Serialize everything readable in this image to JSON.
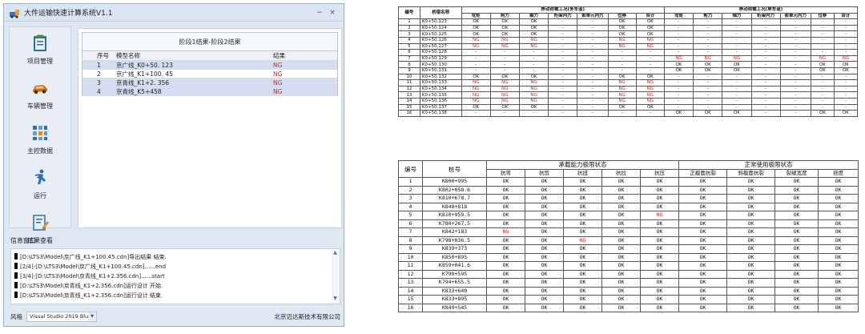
{
  "window": {
    "title": "大件运输快速计算系统V1.1",
    "minimize": "−",
    "close": "×"
  },
  "sidebar": {
    "items": [
      {
        "label": "项目管理",
        "icon": "clipboard-icon"
      },
      {
        "label": "车辆管理",
        "icon": "car-icon"
      },
      {
        "label": "主控数据",
        "icon": "grid-data-icon"
      },
      {
        "label": "运行",
        "icon": "running-man-icon"
      },
      {
        "label": "结果查看",
        "icon": "edit-document-icon"
      }
    ]
  },
  "result_grid": {
    "title": "阶段1结果-阶段2结果",
    "headers": [
      "序号",
      "模型名称",
      "结果"
    ],
    "rows": [
      {
        "no": "1",
        "name": "京广线_K0+50. 123",
        "result": "NG"
      },
      {
        "no": "2",
        "name": "京广线_K1+100. 45",
        "result": "NG"
      },
      {
        "no": "3",
        "name": "京青线_K1+2. 356",
        "result": "NG"
      },
      {
        "no": "4",
        "name": "京青线_K5+458",
        "result": "NG"
      }
    ]
  },
  "info_panel": {
    "label": "信息窗口",
    "lines": [
      "[D:\\LTS3\\Model\\京广线_K1+100.45.cdn]导出结果 结束.",
      "[2/4]-[D:\\LTS3\\Model\\京广线_K1+100.45.cdn]......end",
      "[3/4]-[D:\\LTS3\\Model\\京青线_K1+2.356.cdn]......start",
      "[D:\\LTS3\\Model\\京青线_K1+2.356.cdn]运行设计 开始.",
      "[D:\\LTS3\\Model\\京青线_K1+2.356.cdn]运行设计 结束."
    ]
  },
  "footer": {
    "style_label": "风格",
    "style_value": "Visual Studio 2019 Blue",
    "company": "北京迈达斯技术有限公司"
  },
  "table_top": {
    "col_no": "编号",
    "col_name": "桥梁名称",
    "group_multi": "移动荷载工况(多车道)",
    "group_single": "移动荷载工况(单车道)",
    "sub_headers": [
      "弯矩",
      "剪力",
      "轴力",
      "桁架内力",
      "索单元内力",
      "位移",
      "合计"
    ],
    "rows": [
      {
        "no": "1",
        "pile": "K0+50.123",
        "multi": [
          "OK",
          "OK",
          "OK",
          "-",
          "-",
          "OK",
          "OK"
        ],
        "single": [
          "-",
          "-",
          "-",
          "-",
          "-",
          "-",
          "-"
        ]
      },
      {
        "no": "2",
        "pile": "K0+50.124",
        "multi": [
          "OK",
          "OK",
          "OK",
          "-",
          "-",
          "OK",
          "OK"
        ],
        "single": [
          "-",
          "-",
          "-",
          "-",
          "-",
          "-",
          "-"
        ]
      },
      {
        "no": "3",
        "pile": "K0+50.125",
        "multi": [
          "OK",
          "OK",
          "OK",
          "-",
          "-",
          "OK",
          "OK"
        ],
        "single": [
          "-",
          "-",
          "-",
          "-",
          "-",
          "-",
          "-"
        ]
      },
      {
        "no": "4",
        "pile": "K0+50.126",
        "multi": [
          "NG",
          "NG",
          "NG",
          "-",
          "-",
          "NG",
          "NG"
        ],
        "single": [
          "-",
          "-",
          "-",
          "-",
          "-",
          "-",
          "-"
        ]
      },
      {
        "no": "5",
        "pile": "K0+50.127",
        "multi": [
          "NG",
          "NG",
          "NG",
          "-",
          "-",
          "NG",
          "NG"
        ],
        "single": [
          "-",
          "-",
          "-",
          "-",
          "-",
          "-",
          "-"
        ]
      },
      {
        "no": "6",
        "pile": "K0+50.128",
        "multi": [
          "-",
          "-",
          "-",
          "-",
          "-",
          "-",
          "-"
        ],
        "single": [
          "-",
          "-",
          "-",
          "-",
          "-",
          "-",
          "-"
        ]
      },
      {
        "no": "7",
        "pile": "K0+50.129",
        "multi": [
          "-",
          "-",
          "-",
          "-",
          "-",
          "-",
          "-"
        ],
        "single": [
          "NG",
          "NG",
          "NG",
          "-",
          "-",
          "NG",
          "NG"
        ]
      },
      {
        "no": "8",
        "pile": "K0+50.130",
        "multi": [
          "-",
          "-",
          "-",
          "-",
          "-",
          "-",
          "-"
        ],
        "single": [
          "OK",
          "OK",
          "OK",
          "-",
          "-",
          "OK",
          "OK"
        ]
      },
      {
        "no": "9",
        "pile": "K0+50.131",
        "multi": [
          "-",
          "-",
          "-",
          "-",
          "-",
          "-",
          "-"
        ],
        "single": [
          "OK",
          "OK",
          "OK",
          "-",
          "-",
          "OK",
          "OK"
        ]
      },
      {
        "no": "10",
        "pile": "K0+50.132",
        "multi": [
          "OK",
          "OK",
          "OK",
          "-",
          "-",
          "OK",
          "OK"
        ],
        "single": [
          "-",
          "-",
          "-",
          "-",
          "-",
          "-",
          "-"
        ]
      },
      {
        "no": "11",
        "pile": "K0+50.133",
        "multi": [
          "NG",
          "NG",
          "NG",
          "-",
          "-",
          "NG",
          "NG"
        ],
        "single": [
          "-",
          "-",
          "-",
          "-",
          "-",
          "-",
          "-"
        ]
      },
      {
        "no": "12",
        "pile": "K0+50.134",
        "multi": [
          "NG",
          "NG",
          "NG",
          "-",
          "-",
          "NG",
          "NG"
        ],
        "single": [
          "-",
          "-",
          "-",
          "-",
          "-",
          "-",
          "-"
        ]
      },
      {
        "no": "13",
        "pile": "K0+50.135",
        "multi": [
          "NG",
          "NG",
          "NG",
          "-",
          "-",
          "NG",
          "NG"
        ],
        "single": [
          "-",
          "-",
          "-",
          "-",
          "-",
          "-",
          "-"
        ]
      },
      {
        "no": "14",
        "pile": "K0+50.136",
        "multi": [
          "NG",
          "NG",
          "NG",
          "-",
          "-",
          "NG",
          "NG"
        ],
        "single": [
          "-",
          "-",
          "-",
          "-",
          "-",
          "-",
          "-"
        ]
      },
      {
        "no": "15",
        "pile": "K0+50.137",
        "multi": [
          "OK",
          "OK",
          "OK",
          "-",
          "-",
          "OK",
          "OK"
        ],
        "single": [
          "-",
          "-",
          "-",
          "-",
          "-",
          "-",
          "-"
        ]
      },
      {
        "no": "16",
        "pile": "K0+50.138",
        "multi": [
          "-",
          "-",
          "-",
          "-",
          "-",
          "-",
          "-"
        ],
        "single": [
          "OK",
          "OK",
          "OK",
          "-",
          "-",
          "OK",
          "OK"
        ]
      }
    ]
  },
  "table_bottom": {
    "col_no": "编号",
    "col_pile": "桩号",
    "group_capacity": "承载能力极限状态",
    "group_service": "正常使用极限状态",
    "capacity_headers": [
      "抗弯",
      "抗剪",
      "抗扭",
      "抗拉",
      "抗压"
    ],
    "service_headers": [
      "正截面抗裂",
      "斜截面抗裂",
      "裂缝宽度",
      "挠度"
    ],
    "rows": [
      {
        "no": "1",
        "pile": "K800+995",
        "vals": [
          "OK",
          "OK",
          "OK",
          "OK",
          "OK",
          "OK",
          "OK",
          "OK",
          "OK"
        ]
      },
      {
        "no": "2",
        "pile": "K802+058.6",
        "vals": [
          "OK",
          "OK",
          "OK",
          "OK",
          "OK",
          "OK",
          "OK",
          "OK",
          "OK"
        ]
      },
      {
        "no": "3",
        "pile": "K810+678.7",
        "vals": [
          "OK",
          "OK",
          "OK",
          "OK",
          "OK",
          "OK",
          "OK",
          "OK",
          "OK"
        ]
      },
      {
        "no": "4",
        "pile": "K848+818",
        "vals": [
          "OK",
          "OK",
          "OK",
          "OK",
          "OK",
          "OK",
          "OK",
          "OK",
          "OK"
        ]
      },
      {
        "no": "5",
        "pile": "K810+959.5",
        "vals": [
          "OK",
          "OK",
          "OK",
          "OK",
          "NG",
          "OK",
          "OK",
          "OK",
          "OK"
        ]
      },
      {
        "no": "6",
        "pile": "K780+267.5",
        "vals": [
          "OK",
          "OK",
          "OK",
          "OK",
          "OK",
          "OK",
          "OK",
          "OK",
          "OK"
        ]
      },
      {
        "no": "7",
        "pile": "K842+183",
        "vals": [
          "NG",
          "OK",
          "OK",
          "OK",
          "OK",
          "OK",
          "OK",
          "OK",
          "OK"
        ]
      },
      {
        "no": "8",
        "pile": "K798+036.5",
        "vals": [
          "OK",
          "OK",
          "NG",
          "OK",
          "OK",
          "OK",
          "OK",
          "OK",
          "OK"
        ]
      },
      {
        "no": "9",
        "pile": "K839+373",
        "vals": [
          "OK",
          "OK",
          "OK",
          "OK",
          "OK",
          "OK",
          "OK",
          "OK",
          "OK"
        ]
      },
      {
        "no": "10",
        "pile": "K850+895",
        "vals": [
          "OK",
          "OK",
          "OK",
          "OK",
          "OK",
          "OK",
          "OK",
          "OK",
          "OK"
        ]
      },
      {
        "no": "11",
        "pile": "K859+041.6",
        "vals": [
          "OK",
          "OK",
          "OK",
          "OK",
          "OK",
          "OK",
          "OK",
          "OK",
          "OK"
        ]
      },
      {
        "no": "12",
        "pile": "K790+595",
        "vals": [
          "OK",
          "OK",
          "OK",
          "OK",
          "OK",
          "OK",
          "OK",
          "OK",
          "OK"
        ]
      },
      {
        "no": "13",
        "pile": "K794+655.5",
        "vals": [
          "OK",
          "OK",
          "OK",
          "OK",
          "OK",
          "OK",
          "OK",
          "OK",
          "OK"
        ]
      },
      {
        "no": "14",
        "pile": "K833+640",
        "vals": [
          "OK",
          "OK",
          "OK",
          "OK",
          "OK",
          "OK",
          "OK",
          "OK",
          "OK"
        ]
      },
      {
        "no": "15",
        "pile": "K833+895",
        "vals": [
          "OK",
          "OK",
          "OK",
          "OK",
          "OK",
          "OK",
          "OK",
          "OK",
          "OK"
        ]
      },
      {
        "no": "16",
        "pile": "K849+545",
        "vals": [
          "OK",
          "OK",
          "OK",
          "OK",
          "OK",
          "OK",
          "OK",
          "OK",
          "OK"
        ]
      }
    ]
  },
  "colors": {
    "ng": "#e02020",
    "accent": "#2f5fa8",
    "selection": "#d3dff0"
  }
}
